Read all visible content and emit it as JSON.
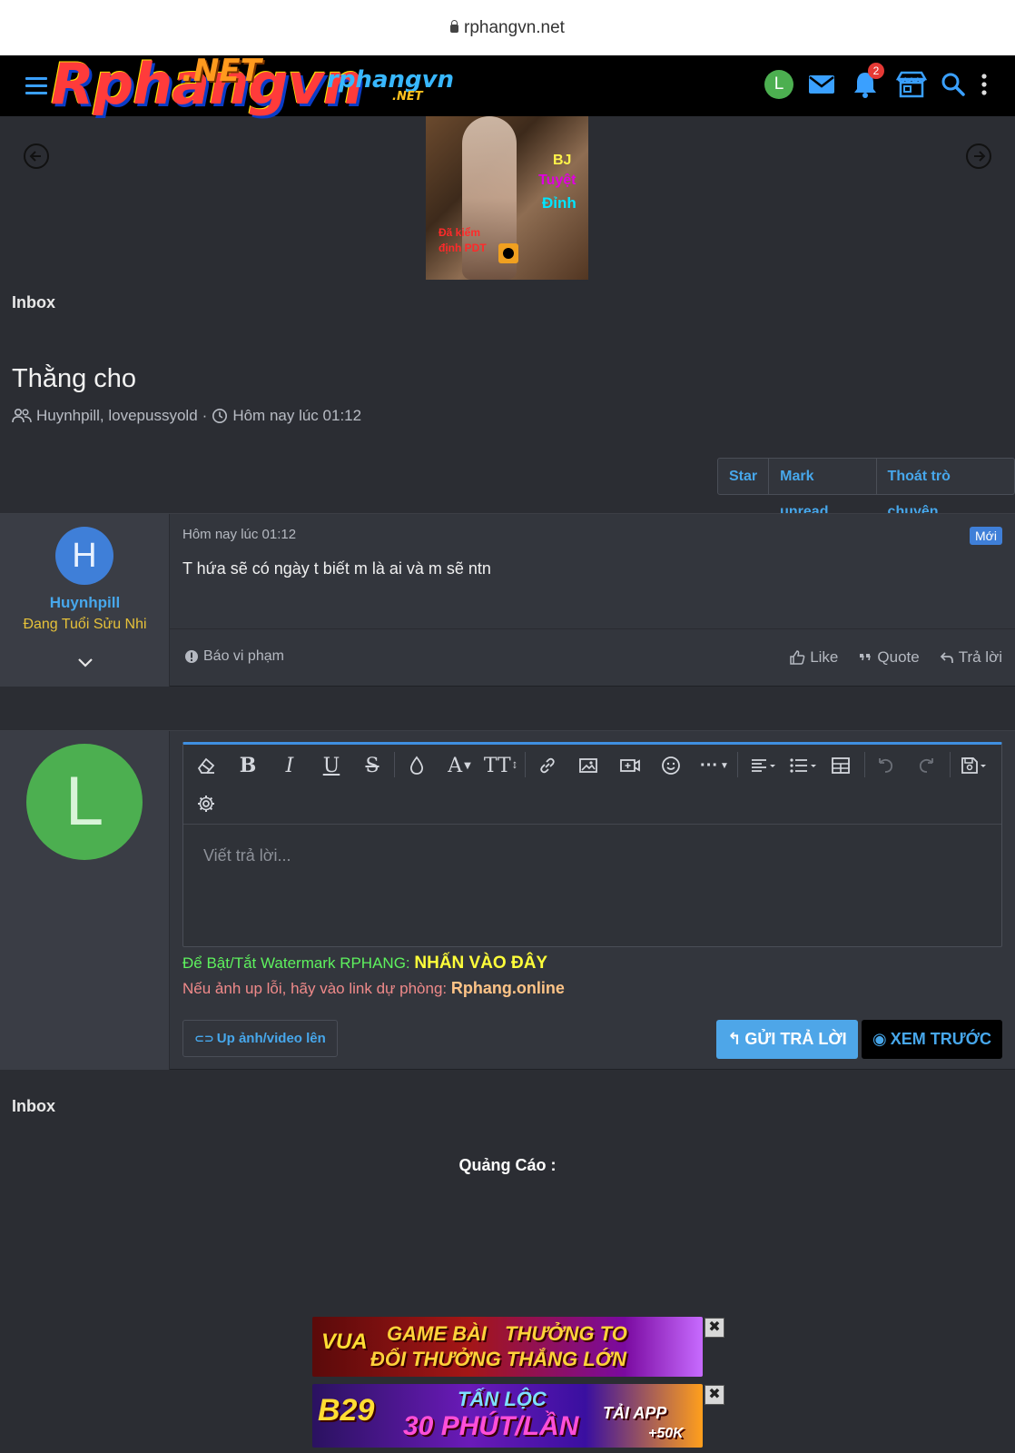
{
  "browser": {
    "url": "rphangvn.net"
  },
  "header": {
    "logo_main": "Rphangvn",
    "logo_suffix": ".NET",
    "logo_small": "rphangvn",
    "logo_small_suffix": ".NET",
    "avatar_letter": "L",
    "notification_count": "2"
  },
  "banner": {
    "text_1": "BJ",
    "text_2": "Tuyệt",
    "text_3": "Đỉnh",
    "text_4_line1": "Đã kiểm",
    "text_4_line2": "định PDT"
  },
  "breadcrumb": {
    "label": "Inbox"
  },
  "conversation": {
    "title": "Thằng cho",
    "participants": "Huynhpill, lovepussyold",
    "separator": "·",
    "time": "Hôm nay lúc 01:12",
    "buttons": {
      "star": "Star",
      "mark_unread": "Mark unread",
      "leave": "Thoát trò chuyện"
    }
  },
  "message": {
    "avatar_letter": "H",
    "author": "Huynhpill",
    "rank": "Đang Tuổi Sửu Nhi",
    "time": "Hôm nay lúc 01:12",
    "new_badge": "Mới",
    "body": "T hứa sẽ có ngày t biết m là ai và m sẽ ntn",
    "report": "Báo vi phạm",
    "like": "Like",
    "quote": "Quote",
    "reply": "Trả lời"
  },
  "reply_box": {
    "avatar_letter": "L",
    "placeholder": "Viết trả lời...",
    "watermark_text": "Để Bật/Tắt Watermark RPHANG: ",
    "watermark_link": "NHẤN VÀO ĐÂY",
    "backup_text": "Nếu ảnh up lỗi, hãy vào link dự phòng: ",
    "backup_link": "Rphang.online",
    "upload_label": "Up ảnh/video lên",
    "send_label": "GỬI TRẢ LỜI",
    "preview_label": "XEM TRƯỚC"
  },
  "footer": {
    "breadcrumb": "Inbox",
    "ads_label": "Quảng Cáo :"
  },
  "ads": [
    {
      "line1": "GAME BÀI",
      "line2": "THƯỞNG TO",
      "line3": "ĐỔI THƯỞNG THẮNG LỚN",
      "brand": "VUA"
    },
    {
      "line1": "TẤN LỘC",
      "line2": "30 PHÚT/LẦN",
      "line3": "TẢI APP",
      "line4": "+50K",
      "brand": "B29"
    }
  ],
  "colors": {
    "accent": "#47a7eb",
    "background": "#2b2d33",
    "success": "#4caf50"
  }
}
